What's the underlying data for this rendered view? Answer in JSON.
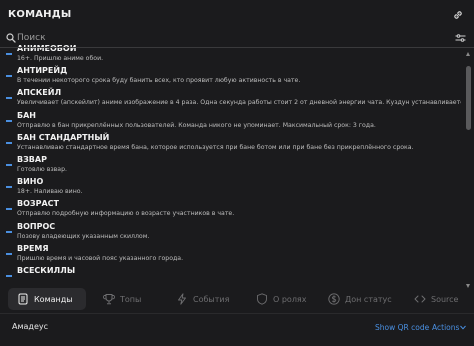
{
  "header": {
    "title": "КОМАНДЫ"
  },
  "search": {
    "placeholder": "Поиск"
  },
  "commands": [
    {
      "name": "АНИМЕОБОИ",
      "desc": "16+. Пришлю аниме обои."
    },
    {
      "name": "АНТИРЕЙД",
      "desc": "В течении некоторого срока буду банить всех, кто проявит любую активность в чате."
    },
    {
      "name": "АПСКЕЙЛ",
      "desc": "Увеличивает (апскейлит) аниме изображение в 4 раза. Одна секунда работы стоит 2 от дневной энергии чата. Куздун устанавливается в зависимости о"
    },
    {
      "name": "БАН",
      "desc": "Отправлю в бан прикреплённых пользователей. Команда никого не упоминает. Максимальный срок: 3 года."
    },
    {
      "name": "БАН СТАНДАРТНЫЙ",
      "desc": "Устанавливаю стандартное время бана, которое используется при бане ботом или при бане без прикреплённого срока."
    },
    {
      "name": "ВЗВАР",
      "desc": "Готовлю взвар."
    },
    {
      "name": "ВИНО",
      "desc": "18+. Наливаю вино."
    },
    {
      "name": "ВОЗРАСТ",
      "desc": "Отправлю подробную информацию о возрасте участников в чате."
    },
    {
      "name": "ВОПРОС",
      "desc": "Позову владеющих указанным скиллом."
    },
    {
      "name": "ВРЕМЯ",
      "desc": "Пришлю время и часовой пояс указанного города."
    },
    {
      "name": "ВСЕСКИЛЛЫ",
      "desc": ""
    }
  ],
  "tabs": [
    {
      "label": "Команды",
      "icon": "document-icon",
      "active": true
    },
    {
      "label": "Топы",
      "icon": "trophy-icon",
      "active": false
    },
    {
      "label": "События",
      "icon": "lightning-icon",
      "active": false
    },
    {
      "label": "О ролях",
      "icon": "shield-icon",
      "active": false
    },
    {
      "label": "Дон статус",
      "icon": "dollar-icon",
      "active": false
    },
    {
      "label": "Source",
      "icon": "code-icon",
      "active": false
    }
  ],
  "footer": {
    "bot_name": "Амадеус",
    "qr_label": "Show QR code",
    "actions_label": "Actions"
  },
  "colors": {
    "background": "#1b1b1d",
    "accent": "#4a90e2",
    "tab_active_bg": "#2b2b2e"
  }
}
